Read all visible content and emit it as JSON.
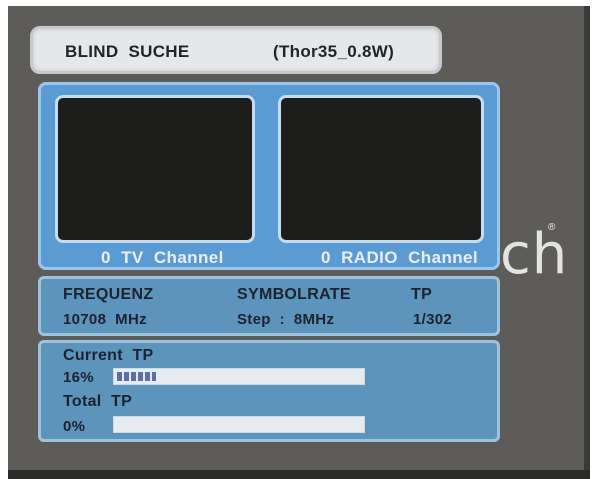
{
  "header": {
    "title": "BLIND  SUCHE",
    "satellite": "(Thor35_0.8W)"
  },
  "channels": {
    "tv_label": "0  TV  Channel",
    "radio_label": "0  RADIO  Channel"
  },
  "watermark": {
    "text": "ch",
    "reg": "®"
  },
  "info": {
    "frequenz_label": "FREQUENZ",
    "frequenz_value": "10708  MHz",
    "symbolrate_label": "SYMBOLRATE",
    "tp_label": "TP",
    "step_value": "Step  :  8MHz",
    "tp_value": "1/302"
  },
  "progress": {
    "current_label": "Current  TP",
    "current_percent_text": "16%",
    "current_fraction": 0.16,
    "total_label": "Total  TP",
    "total_percent_text": "0%",
    "total_fraction": 0.0
  },
  "colors": {
    "frame": "#5d5c58",
    "channel_panel": "#5a9bd3",
    "info_panel": "#5c94bb",
    "progress_fill": "#5b6fa8"
  }
}
